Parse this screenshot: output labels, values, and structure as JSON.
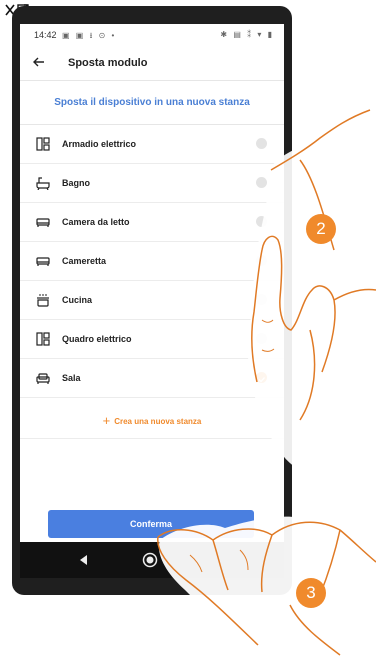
{
  "statusbar": {
    "time": "14:42",
    "left_icons": "▣ ▣ ⭳ ⊙ •",
    "right_icons": "✱ ▤ ⁑ ▾ ▮"
  },
  "appbar": {
    "title": "Sposta modulo"
  },
  "subtitle": "Sposta il dispositivo in una nuova stanza",
  "rooms": [
    {
      "label": "Armadio elettrico",
      "icon": "cabinet-icon",
      "selected": false
    },
    {
      "label": "Bagno",
      "icon": "bathtub-icon",
      "selected": false
    },
    {
      "label": "Camera da letto",
      "icon": "bed-icon",
      "selected": false
    },
    {
      "label": "Cameretta",
      "icon": "bed-icon",
      "selected": false
    },
    {
      "label": "Cucina",
      "icon": "cooking-pot-icon",
      "selected": false
    },
    {
      "label": "Quadro elettrico",
      "icon": "cabinet-icon",
      "selected": false
    },
    {
      "label": "Sala",
      "icon": "sofa-icon",
      "selected": true
    }
  ],
  "create_room": {
    "label": "Crea una nuova stanza",
    "icon": "plus-icon"
  },
  "confirm": {
    "label": "Conferma"
  },
  "annotations": {
    "step_2": "2",
    "step_3": "3"
  },
  "colors": {
    "accent_blue": "#4a7fe0",
    "accent_orange": "#f08a2c"
  }
}
